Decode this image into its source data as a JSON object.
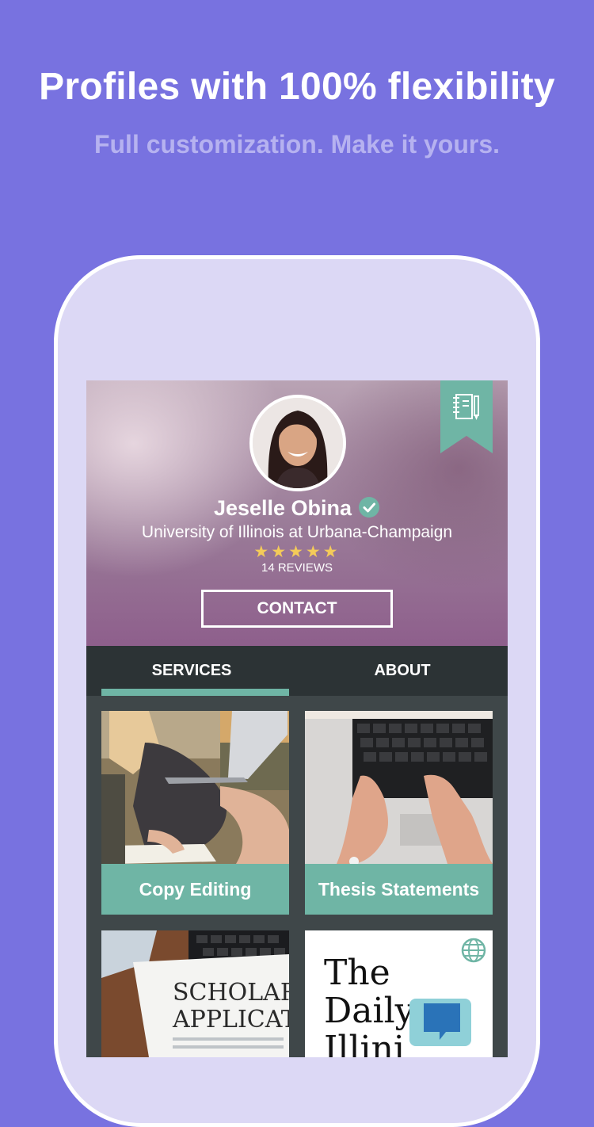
{
  "header": {
    "headline": "Profiles with 100% flexibility",
    "subhead": "Full customization. Make it yours."
  },
  "profile": {
    "name": "Jeselle Obina",
    "school": "University of Illinois at Urbana-Champaign",
    "rating_stars": "★★★★★",
    "rating_value": 5,
    "reviews_label": "14 REVIEWS",
    "contact_label": "CONTACT",
    "verified_icon": "check-badge-icon",
    "bookmark_icon": "notebook-icon"
  },
  "tabs": [
    {
      "label": "SERVICES",
      "active": true
    },
    {
      "label": "ABOUT",
      "active": false
    }
  ],
  "services": [
    {
      "label": "Copy Editing"
    },
    {
      "label": "Thesis Statements"
    },
    {
      "label": ""
    },
    {
      "label": ""
    }
  ],
  "thumbnails": {
    "scholar_text_1": "SCHOLAR",
    "scholar_text_2": "APPLICAT",
    "daily_1": "The",
    "daily_2": "Daily",
    "daily_3": "Illini"
  },
  "colors": {
    "background": "#7872e0",
    "accent": "#6fb5a5",
    "tabbar": "#2c3335",
    "star": "#f4cb59"
  }
}
